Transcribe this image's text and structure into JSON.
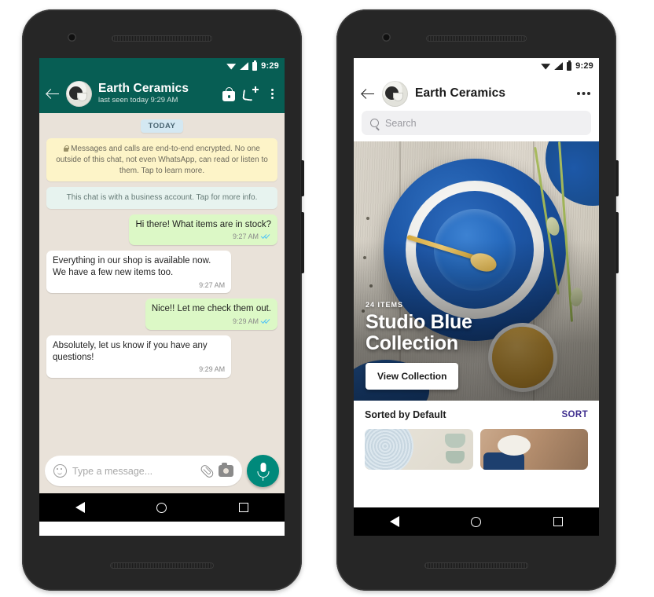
{
  "left_phone": {
    "status_bar": {
      "time": "9:29",
      "icons": [
        "wifi-icon",
        "signal-icon",
        "battery-icon"
      ]
    },
    "chat_header": {
      "back": "back-arrow-icon",
      "avatar": "contact-avatar",
      "name": "Earth Ceramics",
      "subtitle": "last seen today 9:29 AM",
      "actions": [
        "shopping-bag-icon",
        "call-add-icon",
        "overflow-menu-icon"
      ]
    },
    "day_divider": "TODAY",
    "notices": [
      "Messages and calls are end-to-end encrypted. No one outside of this chat, not even WhatsApp, can read or listen to them. Tap to learn more.",
      "This chat is with a business account. Tap for more info."
    ],
    "messages": [
      {
        "text": "Hi there! What items are in stock?",
        "time": "9:27 AM",
        "side": "out",
        "read": true
      },
      {
        "text": "Everything in our shop is available now. We have a few new items too.",
        "time": "9:27 AM",
        "side": "in",
        "read": false
      },
      {
        "text": "Nice!! Let me check them out.",
        "time": "9:29 AM",
        "side": "out",
        "read": true
      },
      {
        "text": "Absolutely, let us know if you have any questions!",
        "time": "9:29 AM",
        "side": "in",
        "read": false
      }
    ],
    "input_bar": {
      "placeholder": "Type a message...",
      "emoji": "emoji-icon",
      "attach": "attachment-clip-icon",
      "camera": "camera-icon",
      "mic": "microphone-button"
    }
  },
  "right_phone": {
    "status_bar": {
      "time": "9:29"
    },
    "catalog_header": {
      "back": "back-arrow-icon",
      "name": "Earth Ceramics",
      "overflow": "overflow-menu-icon"
    },
    "search": {
      "placeholder": "Search",
      "icon": "search-icon"
    },
    "hero": {
      "kicker": "24 ITEMS",
      "title_line1": "Studio Blue",
      "title_line2": "Collection",
      "button": "View Collection"
    },
    "sort": {
      "label": "Sorted by Default",
      "action": "SORT"
    },
    "products": [
      {
        "name": "ribbed-blue-bowl-with-green-cups"
      },
      {
        "name": "potter-holding-ceramic-bowl"
      }
    ]
  },
  "nav_bar": {
    "back": "nav-back-icon",
    "home": "nav-home-icon",
    "recent": "nav-recent-icon"
  },
  "colors": {
    "whatsapp_teal": "#075e54",
    "outgoing_bubble": "#dcf8c6",
    "chat_background": "#e9e2d9",
    "encryption_notice": "#fdf4c8",
    "business_notice": "#e7f3ef",
    "mic_button": "#00897b",
    "sort_accent": "#3f2f8f"
  }
}
